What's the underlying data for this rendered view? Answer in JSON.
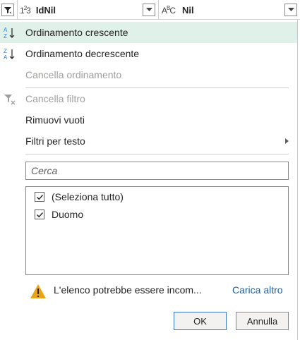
{
  "header": {
    "filter_icon": "filter-icon",
    "col1": {
      "type_icon": "123-icon",
      "name": "IdNil"
    },
    "col2": {
      "type_icon": "abc-icon",
      "name": "Nil"
    }
  },
  "menu": {
    "sort_asc": "Ordinamento crescente",
    "sort_desc": "Ordinamento decrescente",
    "clear_sort": "Cancella ordinamento",
    "clear_filter": "Cancella filtro",
    "remove_empty": "Rimuovi vuoti",
    "text_filters": "Filtri per testo"
  },
  "search": {
    "placeholder": "Cerca"
  },
  "list": {
    "items": [
      {
        "label": "(Seleziona tutto)",
        "checked": true
      },
      {
        "label": "Duomo",
        "checked": true
      }
    ]
  },
  "warning": {
    "text": "L'elenco potrebbe essere incom...",
    "link": "Carica altro"
  },
  "buttons": {
    "ok": "OK",
    "cancel": "Annulla"
  },
  "colors": {
    "highlight": "#dff1e8",
    "link": "#1a5ea8",
    "sort_blue": "#2b7cd3",
    "warning": "#e8a317"
  }
}
